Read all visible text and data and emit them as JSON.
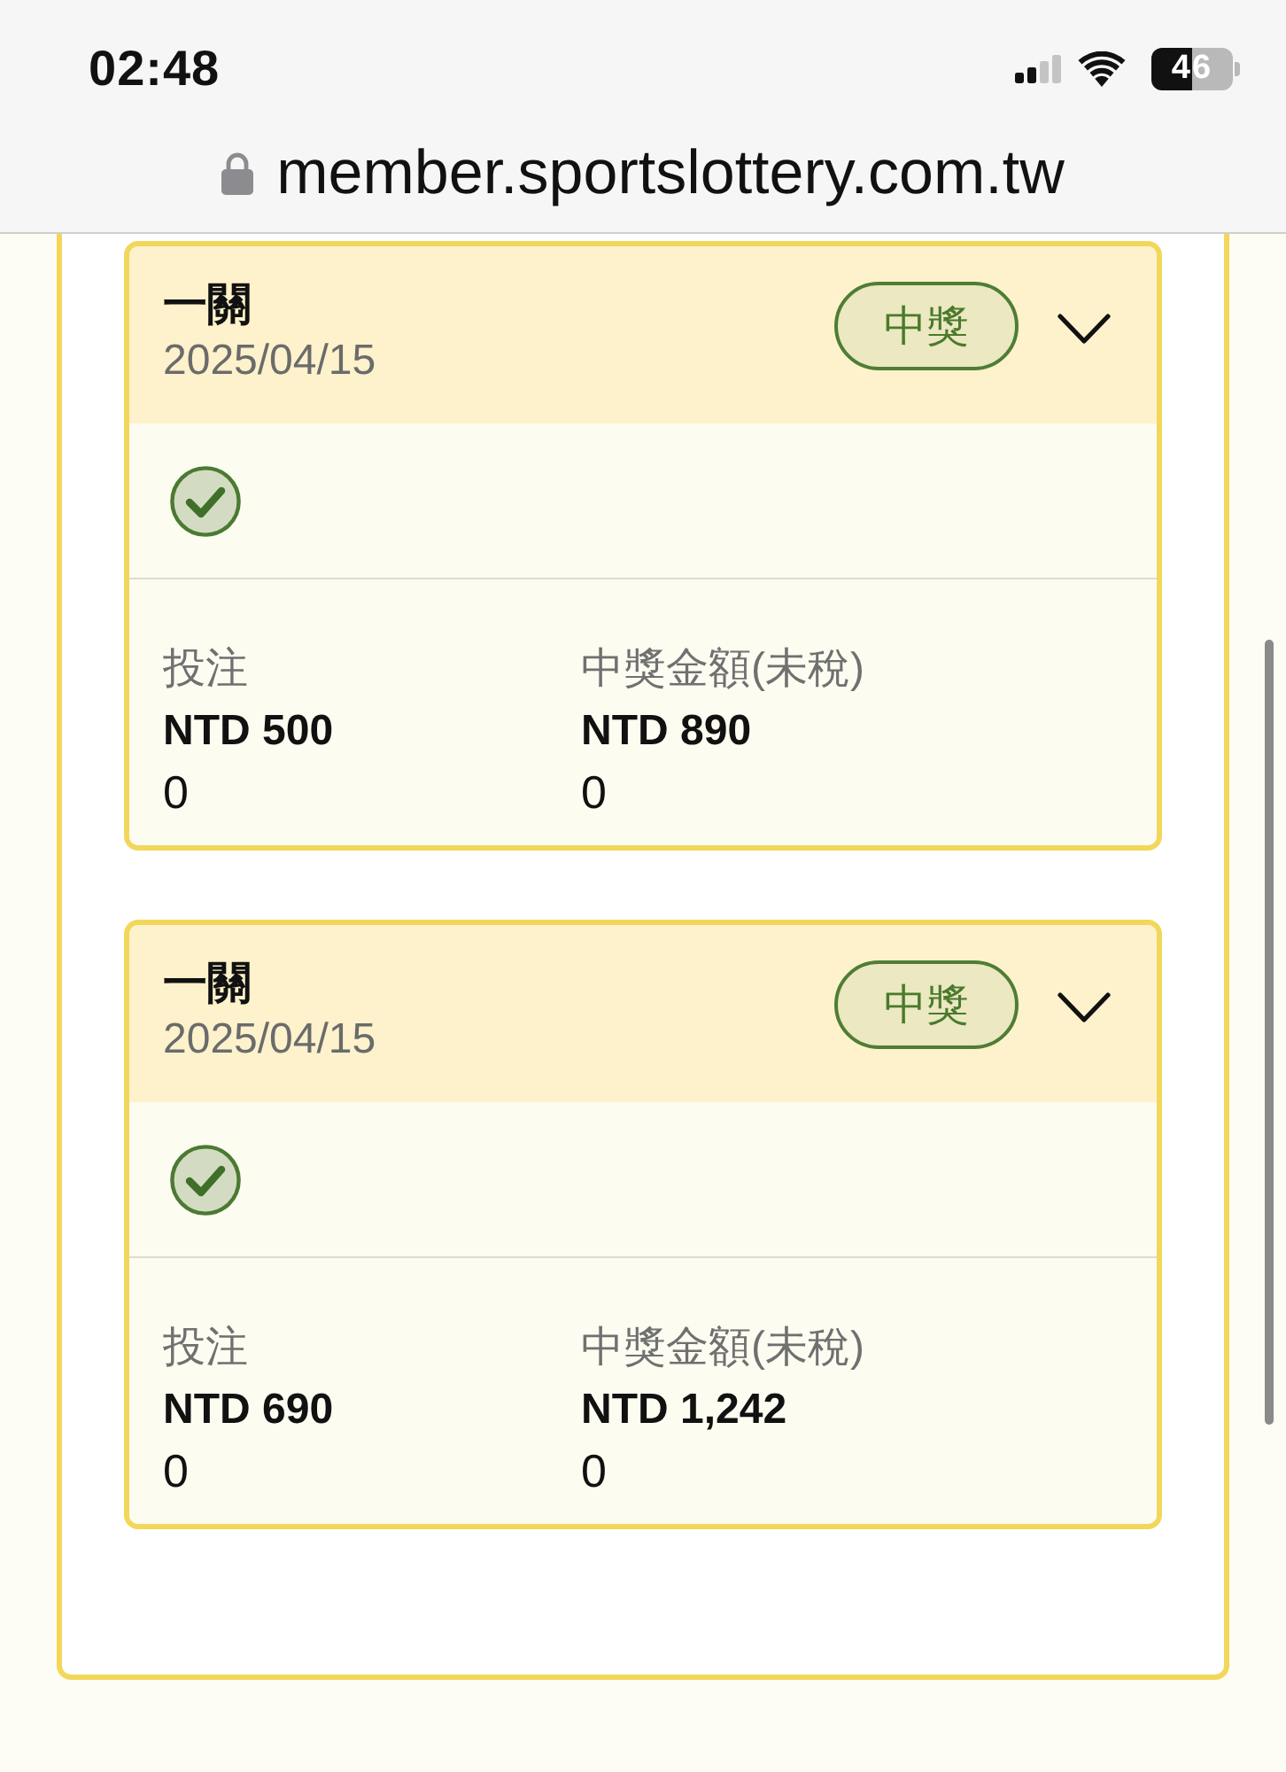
{
  "status_bar": {
    "time": "02:48",
    "battery": "46"
  },
  "address_bar": {
    "url": "member.sportslottery.com.tw"
  },
  "bets": [
    {
      "title": "一關",
      "date": "2025/04/15",
      "badge": "中獎",
      "stats": [
        {
          "label": "投注",
          "value": "NTD 500",
          "note": "0"
        },
        {
          "label": "中獎金額(未稅)",
          "value": "NTD 890",
          "note": "0"
        }
      ]
    },
    {
      "title": "一關",
      "date": "2025/04/15",
      "badge": "中獎",
      "stats": [
        {
          "label": "投注",
          "value": "NTD 690",
          "note": "0"
        },
        {
          "label": "中獎金額(未稅)",
          "value": "NTD 1,242",
          "note": "0"
        }
      ]
    }
  ]
}
